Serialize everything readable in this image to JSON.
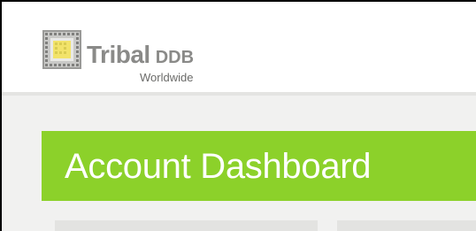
{
  "brand": {
    "name": "Tribal",
    "suffix": "DDB",
    "tagline": "Worldwide",
    "logo_icon": "tribal-grid-logo-icon"
  },
  "page": {
    "title": "Account Dashboard"
  },
  "colors": {
    "header_bg": "#ffffff",
    "page_bg": "#f1f1f0",
    "banner_bg": "#8cd12a",
    "banner_text": "#ffffff",
    "logo_text": "#8a8a88",
    "logo_yellow": "#f2e36a",
    "card_bg": "#e3e3e1"
  }
}
